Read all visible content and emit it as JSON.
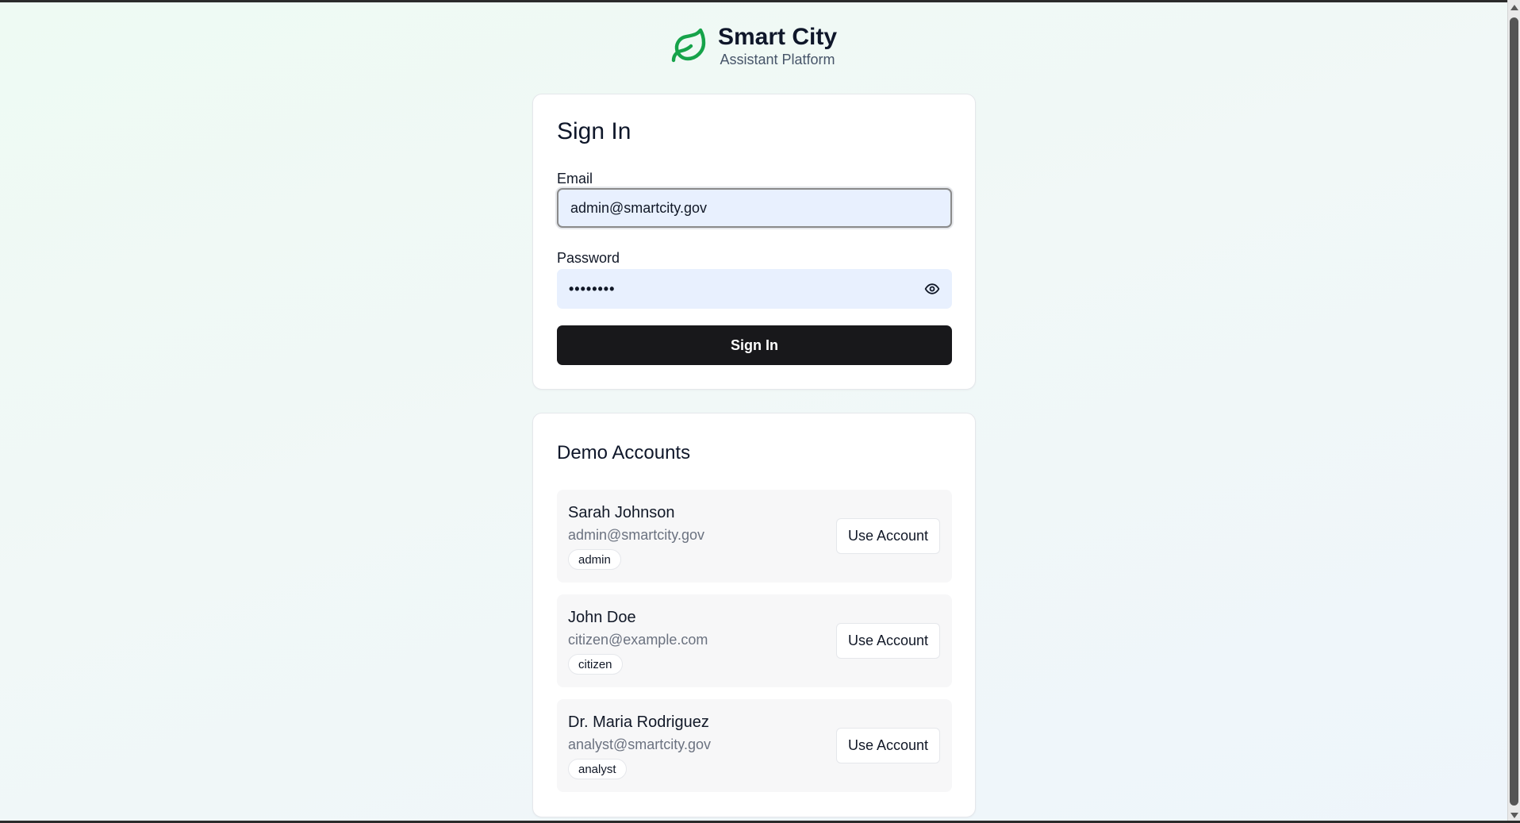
{
  "brand": {
    "title": "Smart City",
    "subtitle": "Assistant Platform",
    "icon": "leaf-icon",
    "accent_color": "#16a34a"
  },
  "signin": {
    "title": "Sign In",
    "email_label": "Email",
    "email_value": "admin@smartcity.gov",
    "password_label": "Password",
    "password_value": "••••••••",
    "submit_label": "Sign In"
  },
  "demo": {
    "title": "Demo Accounts",
    "accounts": [
      {
        "name": "Sarah Johnson",
        "email": "admin@smartcity.gov",
        "role": "admin",
        "action": "Use Account"
      },
      {
        "name": "John Doe",
        "email": "citizen@example.com",
        "role": "citizen",
        "action": "Use Account"
      },
      {
        "name": "Dr. Maria Rodriguez",
        "email": "analyst@smartcity.gov",
        "role": "analyst",
        "action": "Use Account"
      }
    ]
  }
}
